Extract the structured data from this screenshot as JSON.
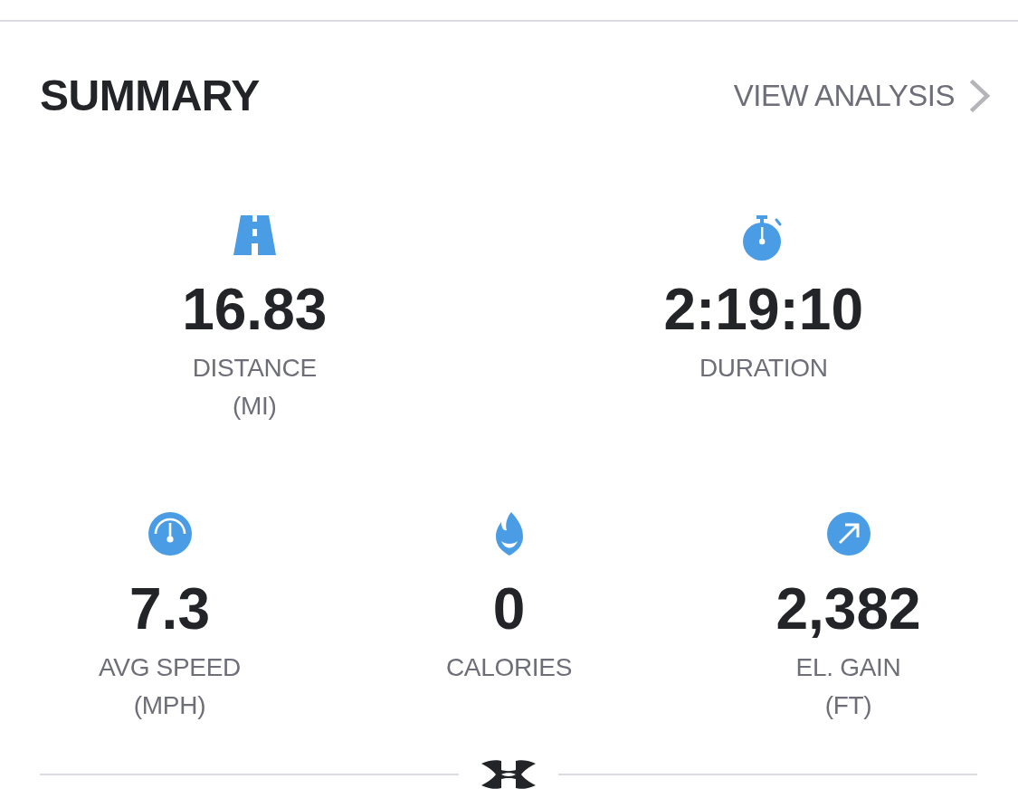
{
  "header": {
    "title": "SUMMARY",
    "link": {
      "label": "VIEW ANALYSIS"
    }
  },
  "rows": [
    {
      "stats": [
        {
          "kind": "distance",
          "value": "16.83",
          "label": "DISTANCE",
          "unit": "(MI)"
        },
        {
          "kind": "duration",
          "value": "2:19:10",
          "label": "DURATION"
        }
      ]
    },
    {
      "stats": [
        {
          "kind": "speed",
          "value": "7.3",
          "label": "AVG SPEED",
          "unit": "(MPH)"
        },
        {
          "kind": "calories",
          "value": "0",
          "label": "CALORIES"
        },
        {
          "kind": "elevation",
          "value": "2,382",
          "label": "EL. GAIN",
          "unit": "(FT)"
        }
      ]
    }
  ]
}
